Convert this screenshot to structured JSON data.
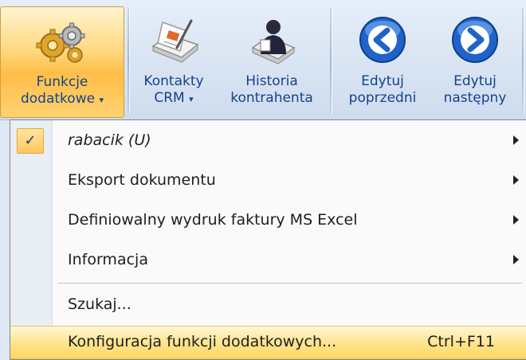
{
  "ribbon": {
    "buttons": [
      {
        "line1": "Funkcje",
        "line2": "dodatkowe",
        "icon": "gears-icon"
      },
      {
        "line1": "Kontakty",
        "line2": "CRM",
        "icon": "crm-contacts-icon"
      },
      {
        "line1": "Historia",
        "line2": "kontrahenta",
        "icon": "customer-history-icon"
      },
      {
        "line1": "Edytuj",
        "line2": "poprzedni",
        "icon": "arrow-left-circle-icon"
      },
      {
        "line1": "Edytuj",
        "line2": "następny",
        "icon": "arrow-right-circle-icon"
      }
    ],
    "dropdown_glyph": "▾"
  },
  "menu": {
    "items": [
      {
        "label": "rabacik (U)",
        "checked": true,
        "submenu": true
      },
      {
        "label": "Eksport dokumentu",
        "submenu": true
      },
      {
        "label": "Definiowalny wydruk faktury MS Excel",
        "submenu": true
      },
      {
        "label": "Informacja",
        "submenu": true
      },
      {
        "label": "Szukaj..."
      },
      {
        "label": "Konfiguracja funkcji dodatkowych...",
        "shortcut": "Ctrl+F11",
        "highlighted": true
      }
    ],
    "check_glyph": "✓"
  },
  "colors": {
    "ribbon_text": "#15428b",
    "active_button": "#ffd87f",
    "menu_highlight": "#ffe796",
    "arrow_blue": "#1f63c9"
  }
}
